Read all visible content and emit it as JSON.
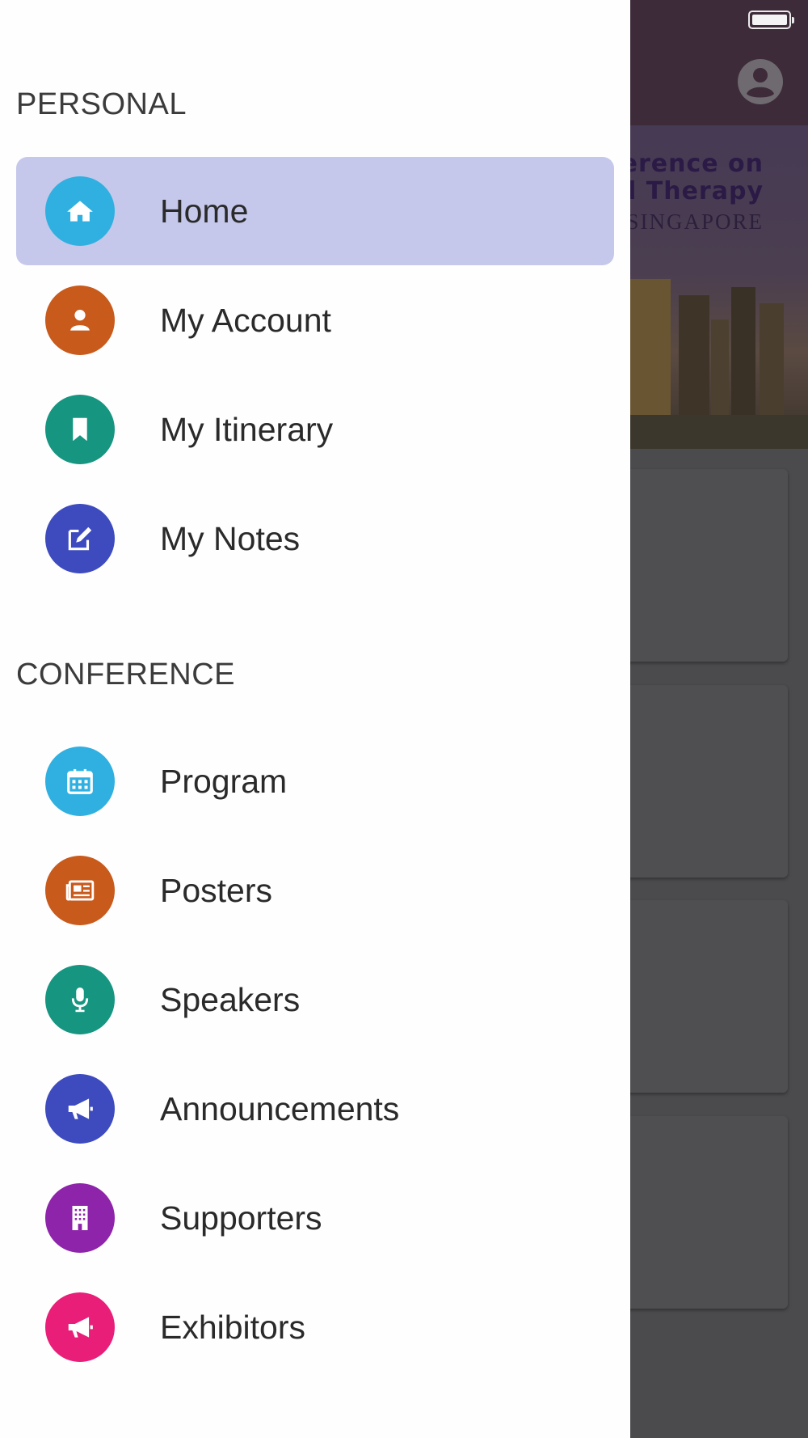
{
  "banner": {
    "line1": "ference on",
    "line2": "nd Therapy",
    "line3": "SINGAPORE"
  },
  "drawer": {
    "sections": [
      {
        "title": "PERSONAL",
        "items": [
          {
            "label": "Home",
            "icon": "home-icon",
            "color": "#30b0e0",
            "active": true
          },
          {
            "label": "My Account",
            "icon": "user-icon",
            "color": "#c85a1c"
          },
          {
            "label": "My Itinerary",
            "icon": "bookmark-icon",
            "color": "#169580"
          },
          {
            "label": "My Notes",
            "icon": "edit-icon",
            "color": "#3d4bbf"
          }
        ]
      },
      {
        "title": "CONFERENCE",
        "items": [
          {
            "label": "Program",
            "icon": "calendar-icon",
            "color": "#30b0e0"
          },
          {
            "label": "Posters",
            "icon": "newspaper-icon",
            "color": "#c85a1c"
          },
          {
            "label": "Speakers",
            "icon": "microphone-icon",
            "color": "#169580"
          },
          {
            "label": "Announcements",
            "icon": "megaphone-icon",
            "color": "#3d4bbf"
          },
          {
            "label": "Supporters",
            "icon": "building-icon",
            "color": "#8e24aa"
          },
          {
            "label": "Exhibitors",
            "icon": "megaphone-icon",
            "color": "#e91e78"
          }
        ]
      }
    ]
  }
}
